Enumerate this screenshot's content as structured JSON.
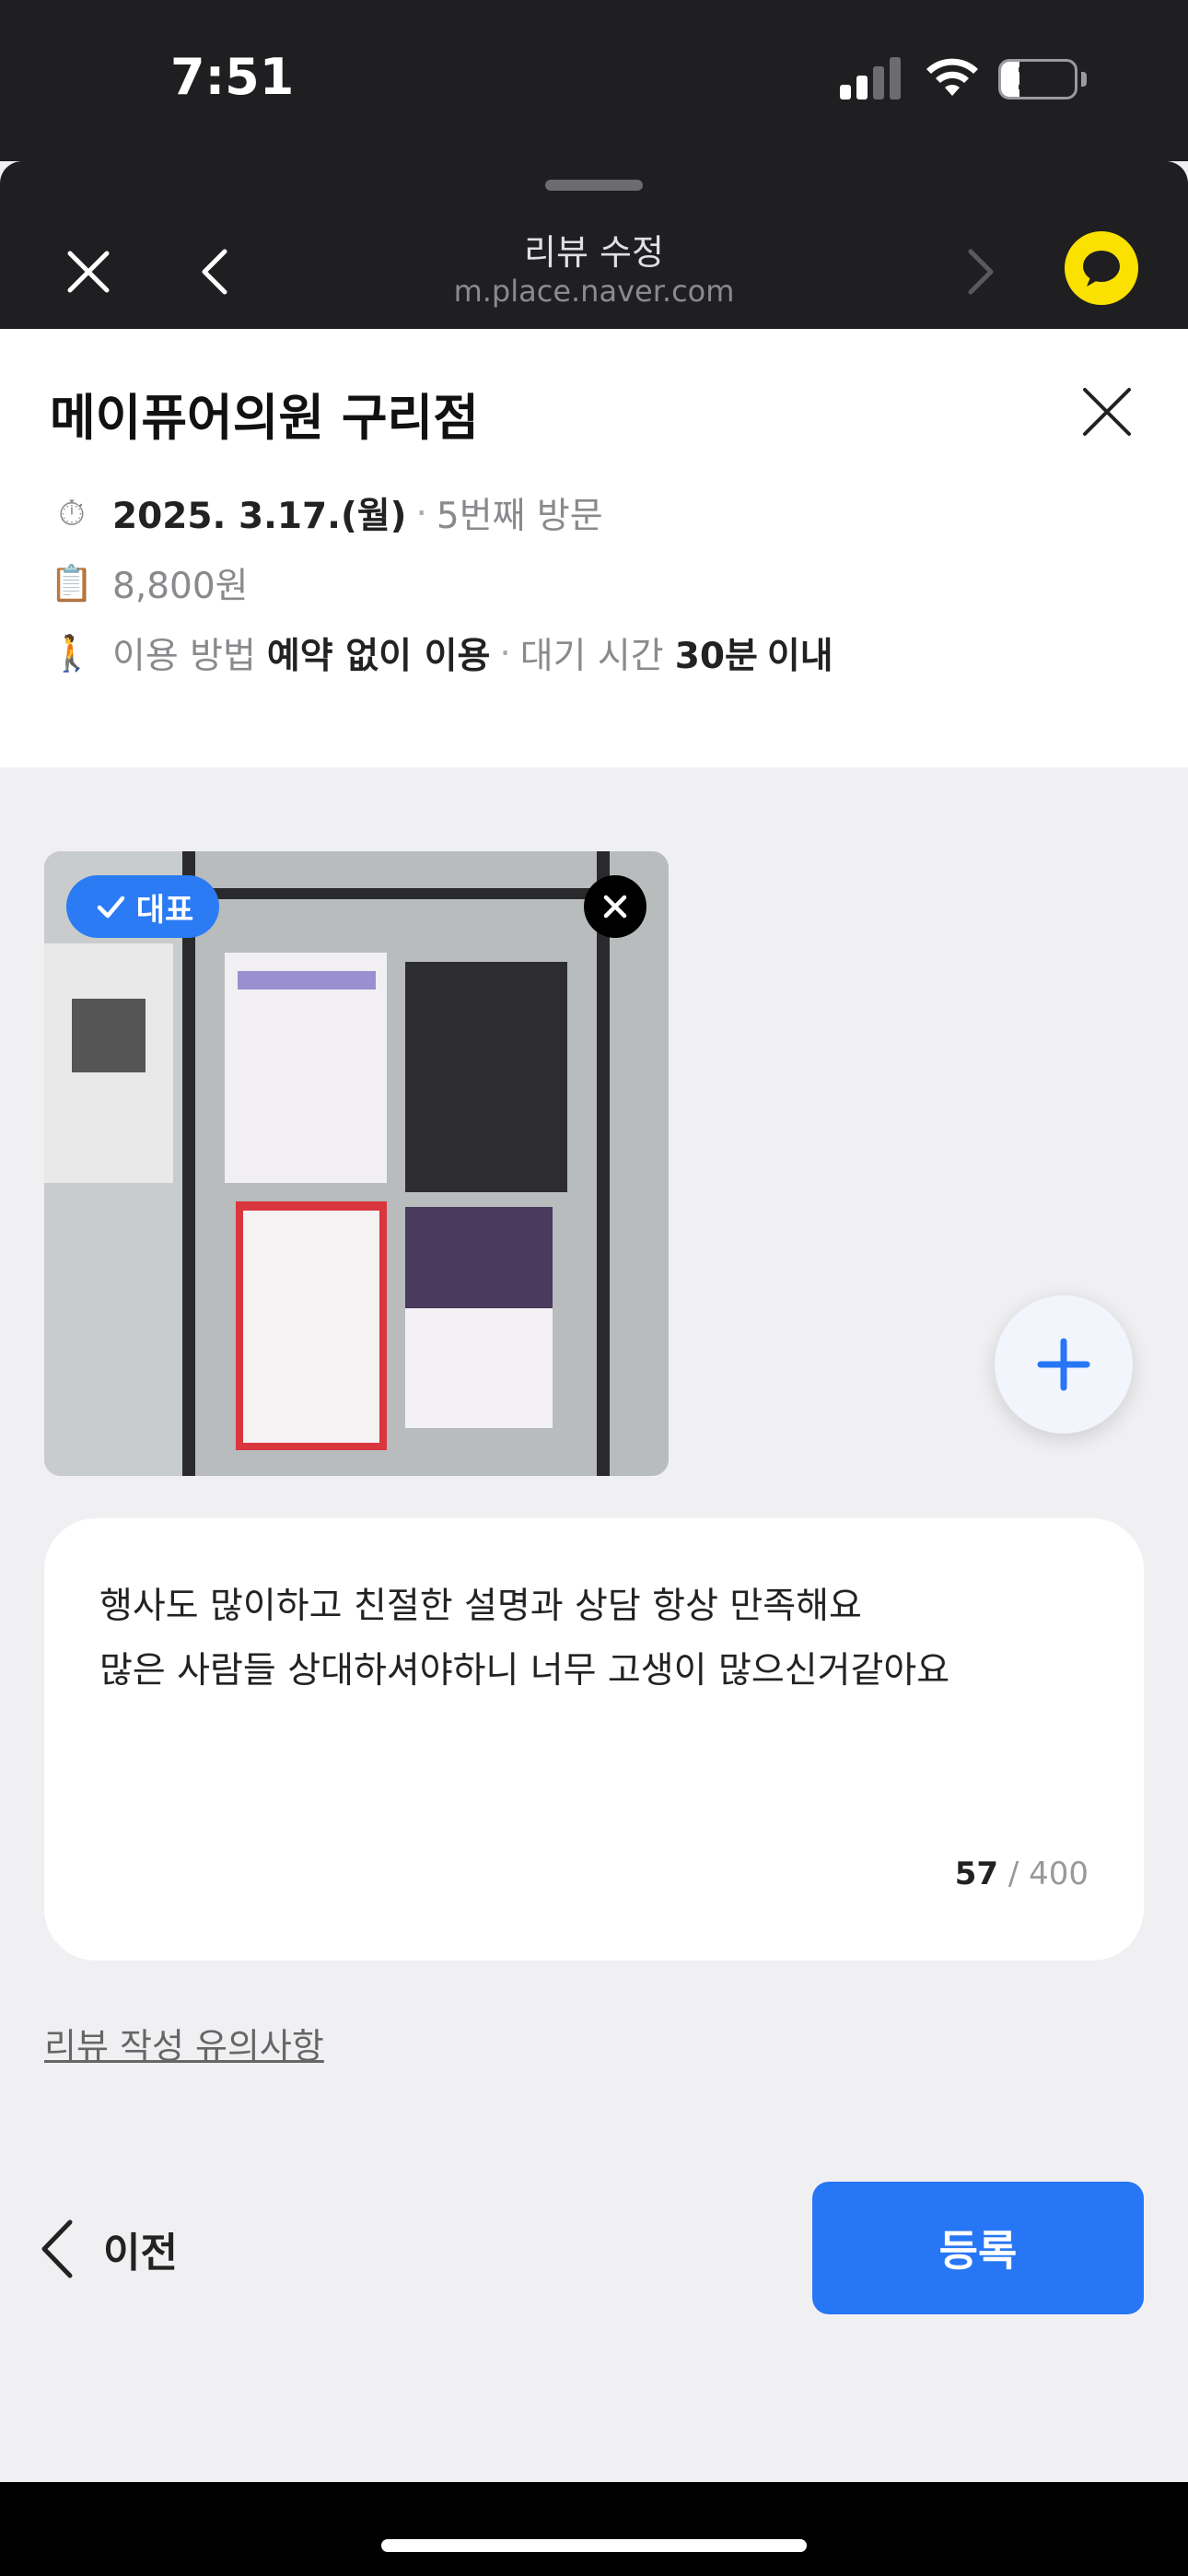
{
  "status": {
    "time": "7:51",
    "battery_level": "25",
    "battery_fraction": 0.25,
    "signal_bars_active": 2,
    "signal_bars_total": 4
  },
  "browser": {
    "title": "리뷰 수정",
    "url": "m.place.naver.com"
  },
  "place": {
    "name": "메이퓨어의원 구리점",
    "visit_date": "2025. 3.17.(월)",
    "visit_count": "5번째 방문",
    "price": "8,800원",
    "usage_label": "이용 방법",
    "usage_value": "예약 없이 이용",
    "wait_label": "대기 시간",
    "wait_number": "30분",
    "wait_suffix": "이내"
  },
  "photo": {
    "badge_label": "대표"
  },
  "review": {
    "line1": "행사도 많이하고 친절한 설명과 상담 항상 만족해요",
    "line2": "많은 사람들 상대하셔야하니 너무 고생이 많으신거같아요",
    "count": "57",
    "max": "/ 400"
  },
  "notice_link": "리뷰 작성 유의사항",
  "footer": {
    "prev_label": "이전",
    "submit_label": "등록"
  },
  "colors": {
    "accent": "#2776f5",
    "kakao_yellow": "#fae100",
    "header_bg": "#1f1f21"
  }
}
